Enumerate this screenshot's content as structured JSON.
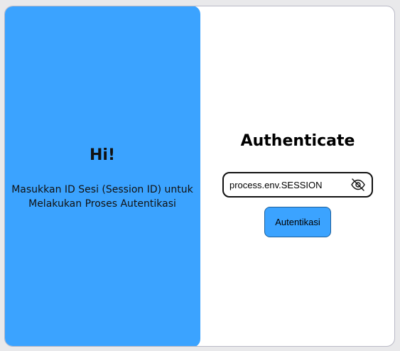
{
  "left_panel": {
    "greeting": "Hi!",
    "instruction": "Masukkan ID Sesi (Session ID) untuk Melakukan Proses Autentikasi",
    "background_color": "#3ba3ff"
  },
  "right_panel": {
    "title": "Authenticate",
    "session_input": {
      "value": "process.env.SESSION",
      "visibility_icon": "eye-slash-icon"
    },
    "submit_label": "Autentikasi",
    "button_color": "#3ba3ff"
  }
}
